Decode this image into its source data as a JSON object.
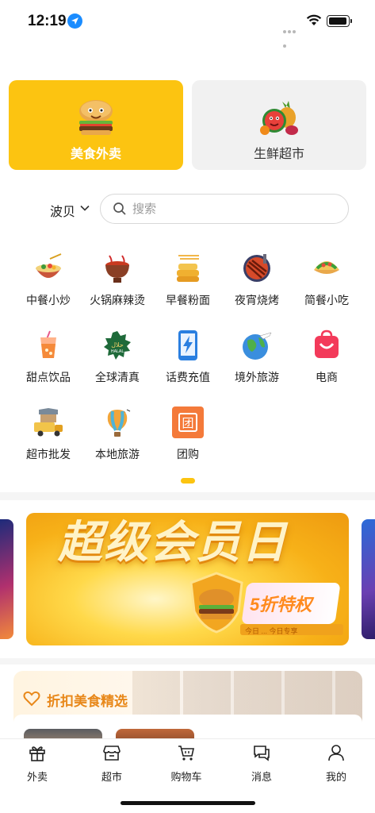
{
  "status_bar": {
    "time": "12:19"
  },
  "top_tabs": [
    {
      "label": "美食外卖",
      "active": true
    },
    {
      "label": "生鲜超市",
      "active": false
    }
  ],
  "location": {
    "city": "波贝"
  },
  "search": {
    "placeholder": "搜索"
  },
  "categories": [
    {
      "label": "中餐小炒",
      "icon": "salad-bowl-icon"
    },
    {
      "label": "火锅麻辣烫",
      "icon": "hotpot-icon"
    },
    {
      "label": "早餐粉面",
      "icon": "noodle-steamer-icon"
    },
    {
      "label": "夜宵烧烤",
      "icon": "grill-icon"
    },
    {
      "label": "简餐小吃",
      "icon": "taco-icon"
    },
    {
      "label": "甜点饮品",
      "icon": "drink-icon"
    },
    {
      "label": "全球清真",
      "icon": "halal-icon"
    },
    {
      "label": "话费充值",
      "icon": "phone-charge-icon"
    },
    {
      "label": "境外旅游",
      "icon": "globe-plane-icon"
    },
    {
      "label": "电商",
      "icon": "shopping-bag-icon"
    },
    {
      "label": "超市批发",
      "icon": "delivery-truck-icon"
    },
    {
      "label": "本地旅游",
      "icon": "hot-air-balloon-icon"
    },
    {
      "label": "团购",
      "icon": "group-buy-icon",
      "icon_text": "团"
    }
  ],
  "banner": {
    "title": "超级会员日",
    "badge": "5折特权",
    "subtext": "今日 ... 今日专享"
  },
  "discount_section": {
    "title": "折扣美食精选"
  },
  "bottom_nav": [
    {
      "label": "外卖",
      "icon": "gift-icon"
    },
    {
      "label": "超市",
      "icon": "store-icon"
    },
    {
      "label": "购物车",
      "icon": "cart-icon"
    },
    {
      "label": "消息",
      "icon": "message-icon"
    },
    {
      "label": "我的",
      "icon": "profile-icon"
    }
  ],
  "colors": {
    "accent": "#fcc411",
    "discount_title": "#e8881a"
  }
}
